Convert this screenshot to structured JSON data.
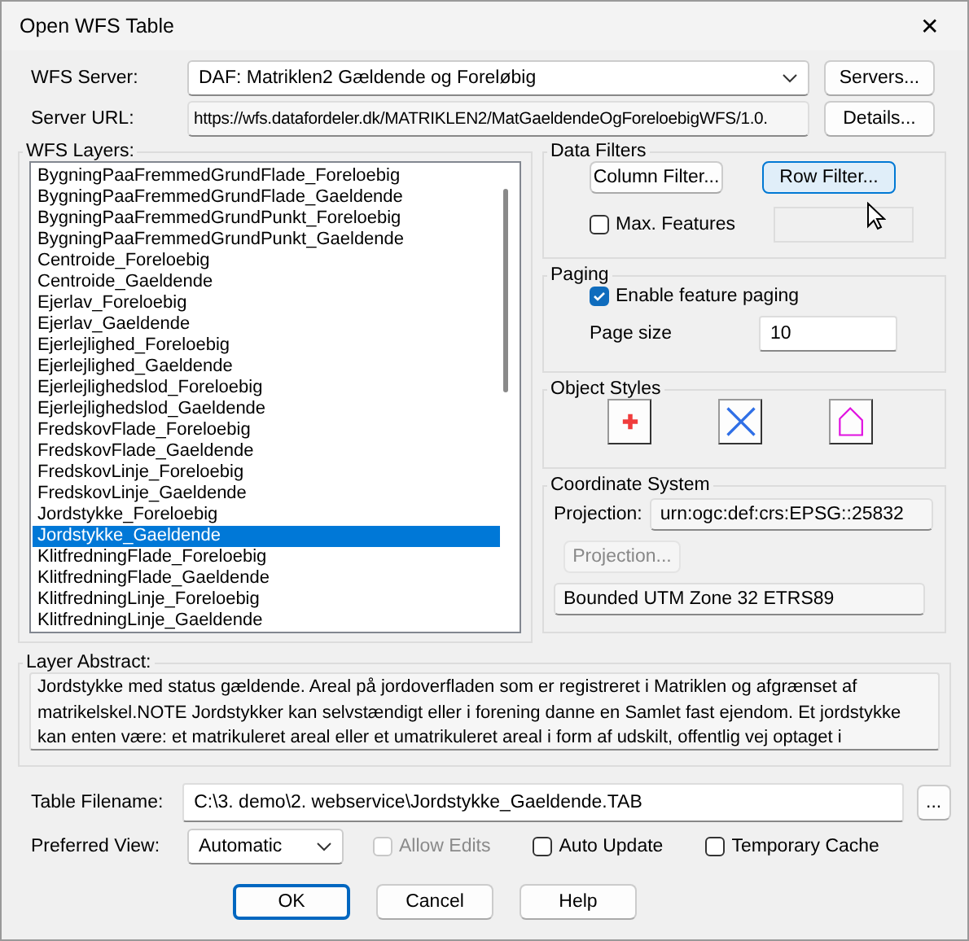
{
  "window": {
    "title": "Open WFS Table",
    "close": "✕"
  },
  "server": {
    "label": "WFS Server:",
    "value": "DAF: Matriklen2 Gældende og Foreløbig",
    "button": "Servers..."
  },
  "url": {
    "label": "Server URL:",
    "value": "https://wfs.datafordeler.dk/MATRIKLEN2/MatGaeldendeOgForeloebigWFS/1.0.",
    "button": "Details..."
  },
  "layers": {
    "title": "WFS Layers:",
    "items": [
      {
        "label": "BygningPaaFremmedGrundFlade_Foreloebig",
        "selected": false
      },
      {
        "label": "BygningPaaFremmedGrundFlade_Gaeldende",
        "selected": false
      },
      {
        "label": "BygningPaaFremmedGrundPunkt_Foreloebig",
        "selected": false
      },
      {
        "label": "BygningPaaFremmedGrundPunkt_Gaeldende",
        "selected": false
      },
      {
        "label": "Centroide_Foreloebig",
        "selected": false
      },
      {
        "label": "Centroide_Gaeldende",
        "selected": false
      },
      {
        "label": "Ejerlav_Foreloebig",
        "selected": false
      },
      {
        "label": "Ejerlav_Gaeldende",
        "selected": false
      },
      {
        "label": "Ejerlejlighed_Foreloebig",
        "selected": false
      },
      {
        "label": "Ejerlejlighed_Gaeldende",
        "selected": false
      },
      {
        "label": "Ejerlejlighedslod_Foreloebig",
        "selected": false
      },
      {
        "label": "Ejerlejlighedslod_Gaeldende",
        "selected": false
      },
      {
        "label": "FredskovFlade_Foreloebig",
        "selected": false
      },
      {
        "label": "FredskovFlade_Gaeldende",
        "selected": false
      },
      {
        "label": "FredskovLinje_Foreloebig",
        "selected": false
      },
      {
        "label": "FredskovLinje_Gaeldende",
        "selected": false
      },
      {
        "label": "Jordstykke_Foreloebig",
        "selected": false
      },
      {
        "label": "Jordstykke_Gaeldende",
        "selected": true
      },
      {
        "label": "KlitfredningFlade_Foreloebig",
        "selected": false
      },
      {
        "label": "KlitfredningFlade_Gaeldende",
        "selected": false
      },
      {
        "label": "KlitfredningLinje_Foreloebig",
        "selected": false
      },
      {
        "label": "KlitfredningLinje_Gaeldende",
        "selected": false
      }
    ]
  },
  "data_filters": {
    "title": "Data Filters",
    "buttons": [
      {
        "label": "Column Filter...",
        "hovered": false
      },
      {
        "label": "Row Filter...",
        "hovered": true
      }
    ],
    "max_features": {
      "label": "Max. Features",
      "checked": false
    }
  },
  "paging": {
    "title": "Paging",
    "enable": {
      "label": "Enable feature paging",
      "checked": true
    },
    "page_size_label": "Page size",
    "page_size": "10"
  },
  "object_styles": {
    "title": "Object Styles",
    "buttons": [
      {
        "kind": "point"
      },
      {
        "kind": "line"
      },
      {
        "kind": "region"
      }
    ]
  },
  "coordinate_system": {
    "title": "Coordinate System",
    "projection_label": "Projection:",
    "projection": "urn:ogc:def:crs:EPSG::25832",
    "button": "Projection...",
    "name": "Bounded UTM Zone 32 ETRS89"
  },
  "abstract": {
    "title": "Layer Abstract:",
    "text": "Jordstykke med status gældende. Areal på jordoverfladen som er registreret i Matriklen og afgrænset af matrikelskel.NOTE Jordstykker kan selvstændigt eller i forening danne en Samlet fast ejendom. Et jordstykke kan enten være: et matrikuleret areal eller et umatrikuleret areal i form af udskilt, offentlig vej optaget i"
  },
  "filename": {
    "label": "Table Filename:",
    "value": "C:\\3. demo\\2. webservice\\Jordstykke_Gaeldende.TAB",
    "button": "..."
  },
  "view": {
    "label": "Preferred View:",
    "value": "Automatic"
  },
  "options": [
    {
      "label": "Allow Edits",
      "checked": false,
      "disabled": true
    },
    {
      "label": "Auto Update",
      "checked": false,
      "disabled": false
    },
    {
      "label": "Temporary Cache",
      "checked": false,
      "disabled": false
    }
  ],
  "buttons": [
    {
      "label": "OK",
      "default": true
    },
    {
      "label": "Cancel",
      "default": false
    },
    {
      "label": "Help",
      "default": false
    }
  ]
}
